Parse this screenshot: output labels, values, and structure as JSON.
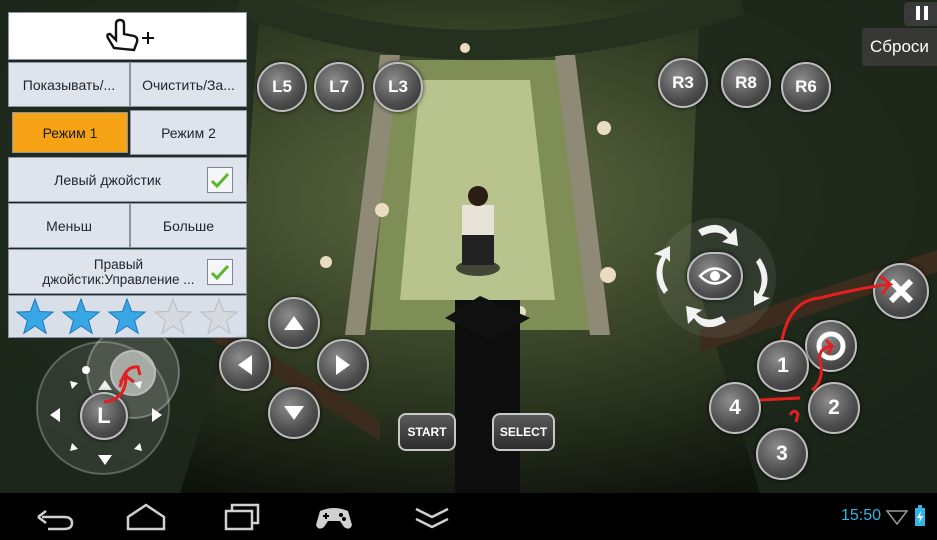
{
  "panel": {
    "row1_left": "Показывать/...",
    "row1_right": "Очистить/За...",
    "mode1": "Режим 1",
    "mode2": "Режим 2",
    "left_joystick": "Левый джойстик",
    "smaller": "Меньш",
    "bigger": "Больше",
    "right_joystick": "Правый джойстик:Управление ...",
    "rating": 3,
    "rating_max": 5
  },
  "shoulder_left": [
    "L5",
    "L7",
    "L3"
  ],
  "shoulder_right": [
    "R3",
    "R8",
    "R6"
  ],
  "face_buttons": [
    "1",
    "2",
    "3",
    "4"
  ],
  "start_label": "START",
  "select_label": "SELECT",
  "stick_label": "L",
  "reset_label": "Сброси",
  "clock": "15:50",
  "colors": {
    "accent": "#f6a316",
    "clock": "#33b5e5",
    "annotation": "#e32020"
  }
}
